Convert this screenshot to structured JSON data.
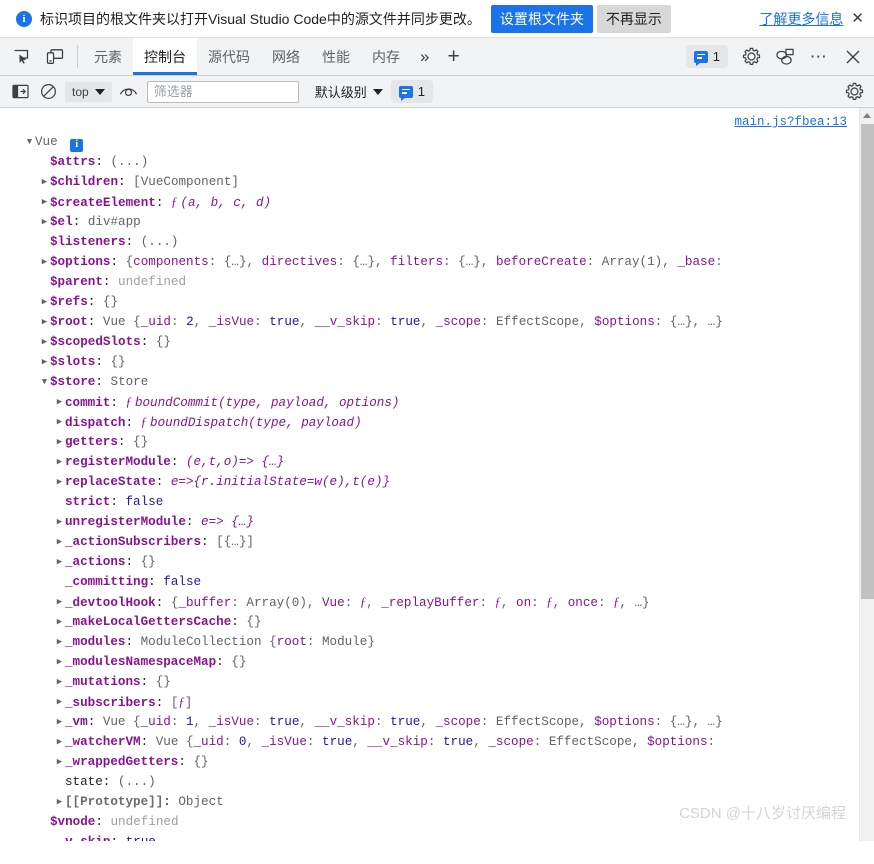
{
  "banner": {
    "icon": "info-circle-icon",
    "message": "标识项目的根文件夹以打开Visual Studio Code中的源文件并同步更改。",
    "primary_button": "设置根文件夹",
    "secondary_button": "不再显示",
    "link": "了解更多信息",
    "close": "✕",
    "primary_color": "#1a73e8"
  },
  "tabbar": {
    "inspect_icon": "inspect-element-icon",
    "device_icon": "device-toolbar-icon",
    "tabs": [
      {
        "label": "元素",
        "selected": false
      },
      {
        "label": "控制台",
        "selected": true
      },
      {
        "label": "源代码",
        "selected": false
      },
      {
        "label": "网络",
        "selected": false
      },
      {
        "label": "性能",
        "selected": false
      },
      {
        "label": "内存",
        "selected": false
      }
    ],
    "more_tabs": "»",
    "add_tab": "+",
    "message_count": "1",
    "settings_icon": "gear-icon",
    "customize_icon": "dock-side-icon",
    "more_icon": "more-options-icon",
    "close_icon": "close-icon"
  },
  "console_toolbar": {
    "sidebar_icon": "console-sidebar-icon",
    "clear_icon": "clear-console-icon",
    "context": "top",
    "eye_icon": "live-expression-icon",
    "filter_placeholder": "筛选器",
    "filter_value": "",
    "level": "默认级别",
    "message_count": "1",
    "settings_icon": "gear-icon"
  },
  "console": {
    "source_link": "main.js?fbea:13",
    "watermark": "CSDN @十八岁讨厌编程",
    "rows": [
      {
        "indent": 0,
        "arrow": "down",
        "segments": [
          {
            "t": "Vue ",
            "c": "k-label"
          },
          {
            "t": "i",
            "c": "badge"
          }
        ]
      },
      {
        "indent": 1,
        "arrow": "none",
        "segments": [
          {
            "t": "$attrs",
            "c": "k-name"
          },
          {
            "t": ": ",
            "c": "k-plain"
          },
          {
            "t": "(...)",
            "c": "k-prev"
          }
        ]
      },
      {
        "indent": 1,
        "arrow": "right",
        "segments": [
          {
            "t": "$children",
            "c": "k-name"
          },
          {
            "t": ": ",
            "c": "k-plain"
          },
          {
            "t": "[VueComponent]",
            "c": "k-prev"
          }
        ]
      },
      {
        "indent": 1,
        "arrow": "right",
        "segments": [
          {
            "t": "$createElement",
            "c": "k-name"
          },
          {
            "t": ": ",
            "c": "k-plain"
          },
          {
            "t": "ƒ ",
            "c": "k-fnkw"
          },
          {
            "t": "(a, b, c, d)",
            "c": "k-fn"
          }
        ]
      },
      {
        "indent": 1,
        "arrow": "right",
        "segments": [
          {
            "t": "$el",
            "c": "k-name"
          },
          {
            "t": ": ",
            "c": "k-plain"
          },
          {
            "t": "div#app",
            "c": "k-prev"
          }
        ]
      },
      {
        "indent": 1,
        "arrow": "none",
        "segments": [
          {
            "t": "$listeners",
            "c": "k-name"
          },
          {
            "t": ": ",
            "c": "k-plain"
          },
          {
            "t": "(...)",
            "c": "k-prev"
          }
        ]
      },
      {
        "indent": 1,
        "arrow": "right",
        "segments": [
          {
            "t": "$options",
            "c": "k-name"
          },
          {
            "t": ": ",
            "c": "k-plain"
          },
          {
            "t": "{",
            "c": "k-prev"
          },
          {
            "t": "components",
            "c": "k-prevkey"
          },
          {
            "t": ": {…}, ",
            "c": "k-prev"
          },
          {
            "t": "directives",
            "c": "k-prevkey"
          },
          {
            "t": ": {…}, ",
            "c": "k-prev"
          },
          {
            "t": "filters",
            "c": "k-prevkey"
          },
          {
            "t": ": {…}, ",
            "c": "k-prev"
          },
          {
            "t": "beforeCreate",
            "c": "k-prevkey"
          },
          {
            "t": ": Array(1), ",
            "c": "k-prev"
          },
          {
            "t": "_base",
            "c": "k-prevkey"
          },
          {
            "t": ":",
            "c": "k-prev"
          }
        ]
      },
      {
        "indent": 1,
        "arrow": "none",
        "segments": [
          {
            "t": "$parent",
            "c": "k-name"
          },
          {
            "t": ": ",
            "c": "k-plain"
          },
          {
            "t": "undefined",
            "c": "k-undef"
          }
        ]
      },
      {
        "indent": 1,
        "arrow": "right",
        "segments": [
          {
            "t": "$refs",
            "c": "k-name"
          },
          {
            "t": ": ",
            "c": "k-plain"
          },
          {
            "t": "{}",
            "c": "k-prev"
          }
        ]
      },
      {
        "indent": 1,
        "arrow": "right",
        "segments": [
          {
            "t": "$root",
            "c": "k-name"
          },
          {
            "t": ": ",
            "c": "k-plain"
          },
          {
            "t": "Vue ",
            "c": "k-prev"
          },
          {
            "t": "{",
            "c": "k-prev"
          },
          {
            "t": "_uid",
            "c": "k-prevkey"
          },
          {
            "t": ": ",
            "c": "k-prev"
          },
          {
            "t": "2",
            "c": "k-num"
          },
          {
            "t": ", ",
            "c": "k-prev"
          },
          {
            "t": "_isVue",
            "c": "k-prevkey"
          },
          {
            "t": ": ",
            "c": "k-prev"
          },
          {
            "t": "true",
            "c": "k-bool"
          },
          {
            "t": ", ",
            "c": "k-prev"
          },
          {
            "t": "__v_skip",
            "c": "k-prevkey"
          },
          {
            "t": ": ",
            "c": "k-prev"
          },
          {
            "t": "true",
            "c": "k-bool"
          },
          {
            "t": ", ",
            "c": "k-prev"
          },
          {
            "t": "_scope",
            "c": "k-prevkey"
          },
          {
            "t": ": EffectScope, ",
            "c": "k-prev"
          },
          {
            "t": "$options",
            "c": "k-prevkey"
          },
          {
            "t": ": {…}, …}",
            "c": "k-prev"
          }
        ]
      },
      {
        "indent": 1,
        "arrow": "right",
        "segments": [
          {
            "t": "$scopedSlots",
            "c": "k-name"
          },
          {
            "t": ": ",
            "c": "k-plain"
          },
          {
            "t": "{}",
            "c": "k-prev"
          }
        ]
      },
      {
        "indent": 1,
        "arrow": "right",
        "segments": [
          {
            "t": "$slots",
            "c": "k-name"
          },
          {
            "t": ": ",
            "c": "k-plain"
          },
          {
            "t": "{}",
            "c": "k-prev"
          }
        ]
      },
      {
        "indent": 1,
        "arrow": "down",
        "segments": [
          {
            "t": "$store",
            "c": "k-name"
          },
          {
            "t": ": ",
            "c": "k-plain"
          },
          {
            "t": "Store",
            "c": "k-prev"
          }
        ]
      },
      {
        "indent": 2,
        "arrow": "right",
        "segments": [
          {
            "t": "commit",
            "c": "k-name"
          },
          {
            "t": ": ",
            "c": "k-plain"
          },
          {
            "t": "ƒ ",
            "c": "k-fnkw"
          },
          {
            "t": "boundCommit(type, payload, options)",
            "c": "k-fn"
          }
        ]
      },
      {
        "indent": 2,
        "arrow": "right",
        "segments": [
          {
            "t": "dispatch",
            "c": "k-name"
          },
          {
            "t": ": ",
            "c": "k-plain"
          },
          {
            "t": "ƒ ",
            "c": "k-fnkw"
          },
          {
            "t": "boundDispatch(type, payload)",
            "c": "k-fn"
          }
        ]
      },
      {
        "indent": 2,
        "arrow": "right",
        "segments": [
          {
            "t": "getters",
            "c": "k-name"
          },
          {
            "t": ": ",
            "c": "k-plain"
          },
          {
            "t": "{}",
            "c": "k-prev"
          }
        ]
      },
      {
        "indent": 2,
        "arrow": "right",
        "segments": [
          {
            "t": "registerModule",
            "c": "k-name"
          },
          {
            "t": ": ",
            "c": "k-plain"
          },
          {
            "t": "(e,t,o)=> {…}",
            "c": "k-fn"
          }
        ]
      },
      {
        "indent": 2,
        "arrow": "right",
        "segments": [
          {
            "t": "replaceState",
            "c": "k-name"
          },
          {
            "t": ": ",
            "c": "k-plain"
          },
          {
            "t": "e=>{r.initialState=w(e),t(e)}",
            "c": "k-fn"
          }
        ]
      },
      {
        "indent": 2,
        "arrow": "none",
        "segments": [
          {
            "t": "strict",
            "c": "k-name"
          },
          {
            "t": ": ",
            "c": "k-plain"
          },
          {
            "t": "false",
            "c": "k-bool"
          }
        ]
      },
      {
        "indent": 2,
        "arrow": "right",
        "segments": [
          {
            "t": "unregisterModule",
            "c": "k-name"
          },
          {
            "t": ": ",
            "c": "k-plain"
          },
          {
            "t": "e=> {…}",
            "c": "k-fn"
          }
        ]
      },
      {
        "indent": 2,
        "arrow": "right",
        "segments": [
          {
            "t": "_actionSubscribers",
            "c": "k-name"
          },
          {
            "t": ": ",
            "c": "k-plain"
          },
          {
            "t": "[{…}]",
            "c": "k-prev"
          }
        ]
      },
      {
        "indent": 2,
        "arrow": "right",
        "segments": [
          {
            "t": "_actions",
            "c": "k-name"
          },
          {
            "t": ": ",
            "c": "k-plain"
          },
          {
            "t": "{}",
            "c": "k-prev"
          }
        ]
      },
      {
        "indent": 2,
        "arrow": "none",
        "segments": [
          {
            "t": "_committing",
            "c": "k-name"
          },
          {
            "t": ": ",
            "c": "k-plain"
          },
          {
            "t": "false",
            "c": "k-bool"
          }
        ]
      },
      {
        "indent": 2,
        "arrow": "right",
        "segments": [
          {
            "t": "_devtoolHook",
            "c": "k-name"
          },
          {
            "t": ": ",
            "c": "k-plain"
          },
          {
            "t": "{",
            "c": "k-prev"
          },
          {
            "t": "_buffer",
            "c": "k-prevkey"
          },
          {
            "t": ": Array(0), ",
            "c": "k-prev"
          },
          {
            "t": "Vue",
            "c": "k-prevkey"
          },
          {
            "t": ": ",
            "c": "k-prev"
          },
          {
            "t": "ƒ",
            "c": "k-fnkw"
          },
          {
            "t": ", ",
            "c": "k-prev"
          },
          {
            "t": "_replayBuffer",
            "c": "k-prevkey"
          },
          {
            "t": ": ",
            "c": "k-prev"
          },
          {
            "t": "ƒ",
            "c": "k-fnkw"
          },
          {
            "t": ", ",
            "c": "k-prev"
          },
          {
            "t": "on",
            "c": "k-prevkey"
          },
          {
            "t": ": ",
            "c": "k-prev"
          },
          {
            "t": "ƒ",
            "c": "k-fnkw"
          },
          {
            "t": ", ",
            "c": "k-prev"
          },
          {
            "t": "once",
            "c": "k-prevkey"
          },
          {
            "t": ": ",
            "c": "k-prev"
          },
          {
            "t": "ƒ",
            "c": "k-fnkw"
          },
          {
            "t": ", …}",
            "c": "k-prev"
          }
        ]
      },
      {
        "indent": 2,
        "arrow": "right",
        "segments": [
          {
            "t": "_makeLocalGettersCache",
            "c": "k-name"
          },
          {
            "t": ": ",
            "c": "k-plain"
          },
          {
            "t": "{}",
            "c": "k-prev"
          }
        ]
      },
      {
        "indent": 2,
        "arrow": "right",
        "segments": [
          {
            "t": "_modules",
            "c": "k-name"
          },
          {
            "t": ": ",
            "c": "k-plain"
          },
          {
            "t": "ModuleCollection ",
            "c": "k-prev"
          },
          {
            "t": "{",
            "c": "k-prev"
          },
          {
            "t": "root",
            "c": "k-prevkey"
          },
          {
            "t": ": Module}",
            "c": "k-prev"
          }
        ]
      },
      {
        "indent": 2,
        "arrow": "right",
        "segments": [
          {
            "t": "_modulesNamespaceMap",
            "c": "k-name"
          },
          {
            "t": ": ",
            "c": "k-plain"
          },
          {
            "t": "{}",
            "c": "k-prev"
          }
        ]
      },
      {
        "indent": 2,
        "arrow": "right",
        "segments": [
          {
            "t": "_mutations",
            "c": "k-name"
          },
          {
            "t": ": ",
            "c": "k-plain"
          },
          {
            "t": "{}",
            "c": "k-prev"
          }
        ]
      },
      {
        "indent": 2,
        "arrow": "right",
        "segments": [
          {
            "t": "_subscribers",
            "c": "k-name"
          },
          {
            "t": ": ",
            "c": "k-plain"
          },
          {
            "t": "[",
            "c": "k-prev"
          },
          {
            "t": "ƒ",
            "c": "k-fnkw"
          },
          {
            "t": "]",
            "c": "k-prev"
          }
        ]
      },
      {
        "indent": 2,
        "arrow": "right",
        "segments": [
          {
            "t": "_vm",
            "c": "k-name"
          },
          {
            "t": ": ",
            "c": "k-plain"
          },
          {
            "t": "Vue ",
            "c": "k-prev"
          },
          {
            "t": "{",
            "c": "k-prev"
          },
          {
            "t": "_uid",
            "c": "k-prevkey"
          },
          {
            "t": ": ",
            "c": "k-prev"
          },
          {
            "t": "1",
            "c": "k-num"
          },
          {
            "t": ", ",
            "c": "k-prev"
          },
          {
            "t": "_isVue",
            "c": "k-prevkey"
          },
          {
            "t": ": ",
            "c": "k-prev"
          },
          {
            "t": "true",
            "c": "k-bool"
          },
          {
            "t": ", ",
            "c": "k-prev"
          },
          {
            "t": "__v_skip",
            "c": "k-prevkey"
          },
          {
            "t": ": ",
            "c": "k-prev"
          },
          {
            "t": "true",
            "c": "k-bool"
          },
          {
            "t": ", ",
            "c": "k-prev"
          },
          {
            "t": "_scope",
            "c": "k-prevkey"
          },
          {
            "t": ": EffectScope, ",
            "c": "k-prev"
          },
          {
            "t": "$options",
            "c": "k-prevkey"
          },
          {
            "t": ": {…}, …}",
            "c": "k-prev"
          }
        ]
      },
      {
        "indent": 2,
        "arrow": "right",
        "segments": [
          {
            "t": "_watcherVM",
            "c": "k-name"
          },
          {
            "t": ": ",
            "c": "k-plain"
          },
          {
            "t": "Vue ",
            "c": "k-prev"
          },
          {
            "t": "{",
            "c": "k-prev"
          },
          {
            "t": "_uid",
            "c": "k-prevkey"
          },
          {
            "t": ": ",
            "c": "k-prev"
          },
          {
            "t": "0",
            "c": "k-num"
          },
          {
            "t": ", ",
            "c": "k-prev"
          },
          {
            "t": "_isVue",
            "c": "k-prevkey"
          },
          {
            "t": ": ",
            "c": "k-prev"
          },
          {
            "t": "true",
            "c": "k-bool"
          },
          {
            "t": ", ",
            "c": "k-prev"
          },
          {
            "t": "__v_skip",
            "c": "k-prevkey"
          },
          {
            "t": ": ",
            "c": "k-prev"
          },
          {
            "t": "true",
            "c": "k-bool"
          },
          {
            "t": ", ",
            "c": "k-prev"
          },
          {
            "t": "_scope",
            "c": "k-prevkey"
          },
          {
            "t": ": EffectScope, ",
            "c": "k-prev"
          },
          {
            "t": "$options",
            "c": "k-prevkey"
          },
          {
            "t": ":",
            "c": "k-prev"
          }
        ]
      },
      {
        "indent": 2,
        "arrow": "right",
        "segments": [
          {
            "t": "_wrappedGetters",
            "c": "k-name"
          },
          {
            "t": ": ",
            "c": "k-plain"
          },
          {
            "t": "{}",
            "c": "k-prev"
          }
        ]
      },
      {
        "indent": 2,
        "arrow": "none",
        "segments": [
          {
            "t": "state",
            "c": "k-plain"
          },
          {
            "t": ": ",
            "c": "k-plain"
          },
          {
            "t": "(...)",
            "c": "k-prev"
          }
        ]
      },
      {
        "indent": 2,
        "arrow": "right",
        "segments": [
          {
            "t": "[[Prototype]]",
            "c": "k-proto"
          },
          {
            "t": ": ",
            "c": "k-plain"
          },
          {
            "t": "Object",
            "c": "k-prev"
          }
        ]
      },
      {
        "indent": 1,
        "arrow": "none",
        "segments": [
          {
            "t": "$vnode",
            "c": "k-name"
          },
          {
            "t": ": ",
            "c": "k-plain"
          },
          {
            "t": "undefined",
            "c": "k-undef"
          }
        ]
      },
      {
        "indent": 1,
        "arrow": "none",
        "segments": [
          {
            "t": "__v_skip",
            "c": "k-name"
          },
          {
            "t": ": ",
            "c": "k-plain"
          },
          {
            "t": "true",
            "c": "k-bool"
          }
        ]
      }
    ]
  }
}
